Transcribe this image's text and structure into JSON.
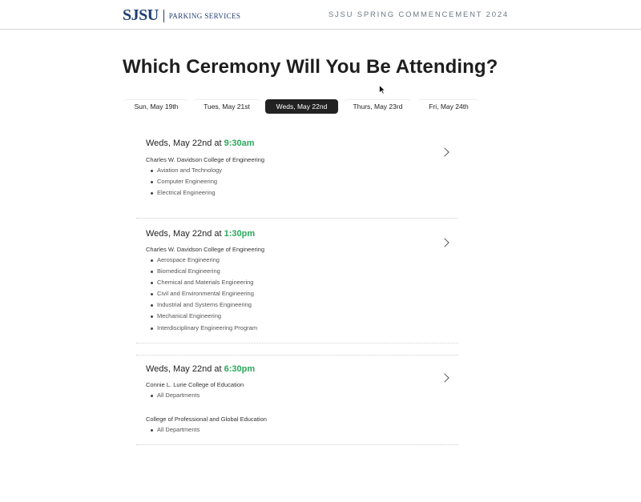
{
  "header": {
    "logo_mark": "SJSU",
    "logo_sub": "PARKING SERVICES",
    "event_title": "SJSU SPRING COMMENCEMENT 2024"
  },
  "page_title": "Which Ceremony Will You Be Attending?",
  "tabs": [
    {
      "label": "Sun, May 19th",
      "active": false
    },
    {
      "label": "Tues, May 21st",
      "active": false
    },
    {
      "label": "Weds, May 22nd",
      "active": true
    },
    {
      "label": "Thurs, May 23rd",
      "active": false
    },
    {
      "label": "Fri, May 24th",
      "active": false
    }
  ],
  "ceremonies": [
    {
      "date_prefix": "Weds, May 22nd at ",
      "time": "9:30am",
      "groups": [
        {
          "college": "Charles W. Davidson College of Engineering",
          "departments": [
            "Aviation and Technology",
            "Computer Engineering",
            "Electrical Engineering"
          ]
        }
      ]
    },
    {
      "date_prefix": "Weds, May 22nd at ",
      "time": "1:30pm",
      "groups": [
        {
          "college": "Charles W. Davidson College of Engineering",
          "departments": [
            "Aerospace Engineering",
            "Biomedical Engineering",
            "Chemical and Materials Engineering",
            "Civil and Environmental Engineering",
            "Industrial and Systems Engineering",
            "Mechanical Engineering",
            "Interdisciplinary Engineering Program"
          ]
        }
      ]
    },
    {
      "date_prefix": "Weds, May 22nd at ",
      "time": "6:30pm",
      "groups": [
        {
          "college": "Connie L. Lurie College of Education",
          "departments": [
            "All Departments"
          ]
        },
        {
          "college": "College of Professional and Global Education",
          "departments": [
            "All Departments"
          ]
        }
      ]
    }
  ],
  "colors": {
    "brand": "#1f3f73",
    "time_accent": "#2aa85a",
    "active_tab_bg": "#222222"
  },
  "icons": {
    "chevron": "chevron-right-icon",
    "cursor": "mouse-pointer-icon"
  }
}
